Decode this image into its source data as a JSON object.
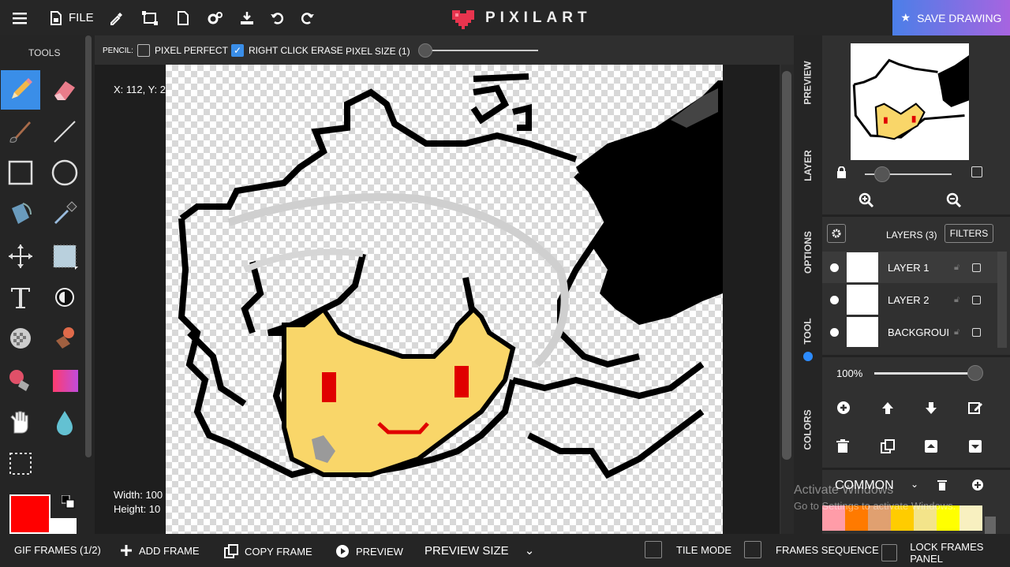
{
  "app": {
    "name": "PIXILART"
  },
  "topbar": {
    "file_label": "FILE",
    "save_label": "SAVE DRAWING",
    "icons": [
      "menu-icon",
      "file-icon",
      "eyedropper-icon",
      "resize-icon",
      "document-icon",
      "settings-icon",
      "download-icon",
      "undo-icon",
      "redo-icon"
    ]
  },
  "tools": {
    "header": "TOOLS",
    "items": [
      "pencil",
      "eraser",
      "brush",
      "line",
      "rectangle",
      "circle",
      "bucket",
      "eyedropper",
      "move",
      "select",
      "text",
      "lighten",
      "dither",
      "stamp",
      "fill-paint",
      "gradient",
      "hand",
      "drop",
      "marquee"
    ],
    "active": "pencil",
    "primary_color": "#ff0000",
    "secondary_color": "#ffffff"
  },
  "options": {
    "tool_label": "PENCIL:",
    "pixel_perfect": {
      "label": "PIXEL PERFECT",
      "checked": false
    },
    "right_click_erase": {
      "label": "RIGHT CLICK ERASE",
      "checked": true
    },
    "pixel_size_label": "PIXEL SIZE (1)"
  },
  "canvas": {
    "coords_text": "X: 112, Y: 2",
    "width_text": "Width: 100",
    "height_text": "Height: 10"
  },
  "side_tabs": [
    "PREVIEW",
    "LAYER",
    "OPTIONS",
    "TOOL",
    "COLORS"
  ],
  "layers": {
    "header": "LAYERS (3)",
    "filters_label": "FILTERS",
    "opacity_text": "100%",
    "items": [
      {
        "name": "LAYER 1"
      },
      {
        "name": "LAYER 2"
      },
      {
        "name": "BACKGROUI"
      }
    ]
  },
  "palette": {
    "label": "COMMON",
    "colors": [
      "#ff9ca8",
      "#ff7a00",
      "#e0a070",
      "#ffcc00",
      "#f3e48a",
      "#ffff00",
      "#f8f0c0"
    ]
  },
  "watermark": {
    "line1": "Activate Windows",
    "line2": "Go to Settings to activate Windows."
  },
  "bottombar": {
    "gif_frames": "GIF FRAMES (1/2)",
    "add_frame": "ADD FRAME",
    "copy_frame": "COPY FRAME",
    "preview": "PREVIEW",
    "preview_size": "PREVIEW SIZE",
    "tile_mode": "TILE MODE",
    "frames_sequence": "FRAMES SEQUENCE",
    "lock_frames_panel": "LOCK FRAMES PANEL"
  }
}
